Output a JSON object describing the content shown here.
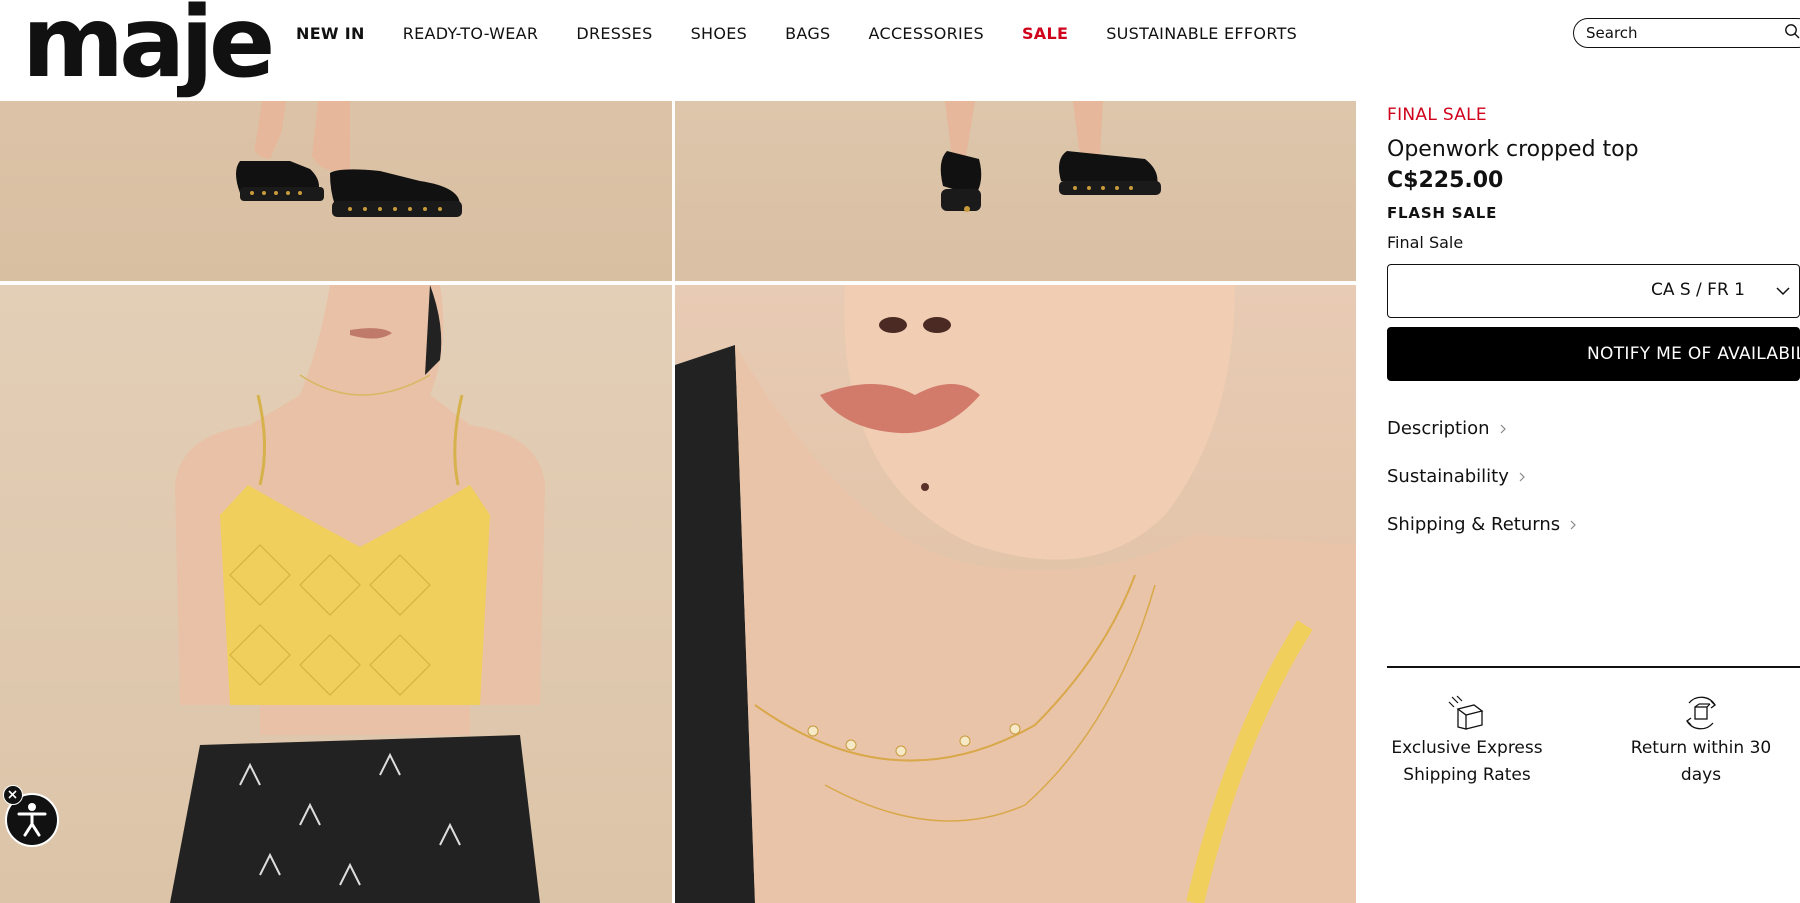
{
  "header": {
    "logo": "maje",
    "nav": [
      {
        "label": "NEW IN"
      },
      {
        "label": "READY-TO-WEAR"
      },
      {
        "label": "DRESSES"
      },
      {
        "label": "SHOES"
      },
      {
        "label": "BAGS"
      },
      {
        "label": "ACCESSORIES"
      },
      {
        "label": "SALE"
      },
      {
        "label": "SUSTAINABLE EFFORTS"
      }
    ],
    "search_placeholder": "Search"
  },
  "product": {
    "final_sale_label": "FINAL SALE",
    "title": "Openwork cropped top",
    "price": "C$225.00",
    "flash_sale": "FLASH SALE",
    "final_sale_note": "Final Sale",
    "size_selected": "CA S / FR 1",
    "notify_button": "NOTIFY ME OF AVAILABILITY",
    "accordions": [
      {
        "label": "Description"
      },
      {
        "label": "Sustainability"
      },
      {
        "label": "Shipping & Returns"
      }
    ],
    "perks": [
      {
        "label": "Exclusive Express Shipping Rates",
        "icon": "box-icon"
      },
      {
        "label": "Return within 30 days",
        "icon": "return-box-icon"
      }
    ]
  },
  "colors": {
    "sale_red": "#d0021b",
    "text": "#111111",
    "button_bg": "#000000",
    "photo_bg": "#dcc3a7",
    "top_yellow": "#f0cf5c"
  }
}
